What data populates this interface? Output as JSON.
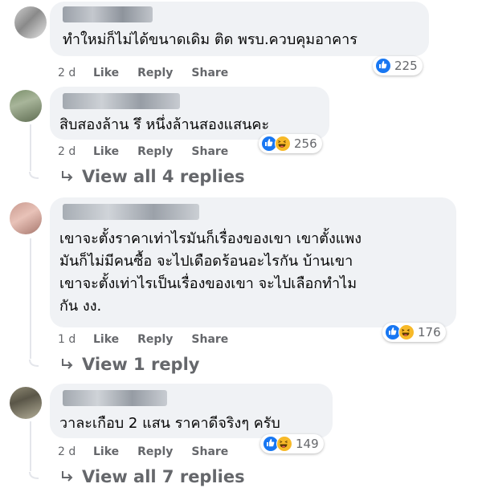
{
  "comments": [
    {
      "text_lines": [
        "ทำใหม่ก็ไม่ได้ขนาดเดิม ติด พรบ.ควบคุมอาคาร"
      ],
      "time": "2 d",
      "like": "Like",
      "reply": "Reply",
      "share": "Share",
      "reactions": [
        "like"
      ],
      "reaction_count": "225"
    },
    {
      "text_lines": [
        "สิบสองล้าน รึ หนึ่งล้านสองแสนคะ"
      ],
      "time": "2 d",
      "like": "Like",
      "reply": "Reply",
      "share": "Share",
      "reactions": [
        "like",
        "haha"
      ],
      "reaction_count": "256",
      "view_replies": "View all 4 replies"
    },
    {
      "text_lines": [
        "เขาจะตั้งราคาเท่าไรมันก็เรื่องของเขา เขาตั้งแพง",
        "มันก็ไม่มีคนซื้อ จะไปเดือดร้อนอะไรกัน บ้านเขา",
        "เขาจะตั้งเท่าไรเป็นเรื่องของเขา จะไปเลือกทำไม",
        "กัน งง."
      ],
      "time": "1 d",
      "like": "Like",
      "reply": "Reply",
      "share": "Share",
      "reactions": [
        "like",
        "haha"
      ],
      "reaction_count": "176",
      "view_replies": "View 1 reply"
    },
    {
      "text_lines": [
        "วาละเกือบ 2 แสน ราคาดีจริงๆ ครับ"
      ],
      "time": "2 d",
      "like": "Like",
      "reply": "Reply",
      "share": "Share",
      "reactions": [
        "like",
        "haha"
      ],
      "reaction_count": "149",
      "view_replies": "View all 7 replies"
    }
  ],
  "colors": {
    "bubble": "#f0f2f5",
    "secondary_text": "#65676b",
    "like_blue": "#1877f2",
    "haha_yellow": "#f7b928"
  }
}
